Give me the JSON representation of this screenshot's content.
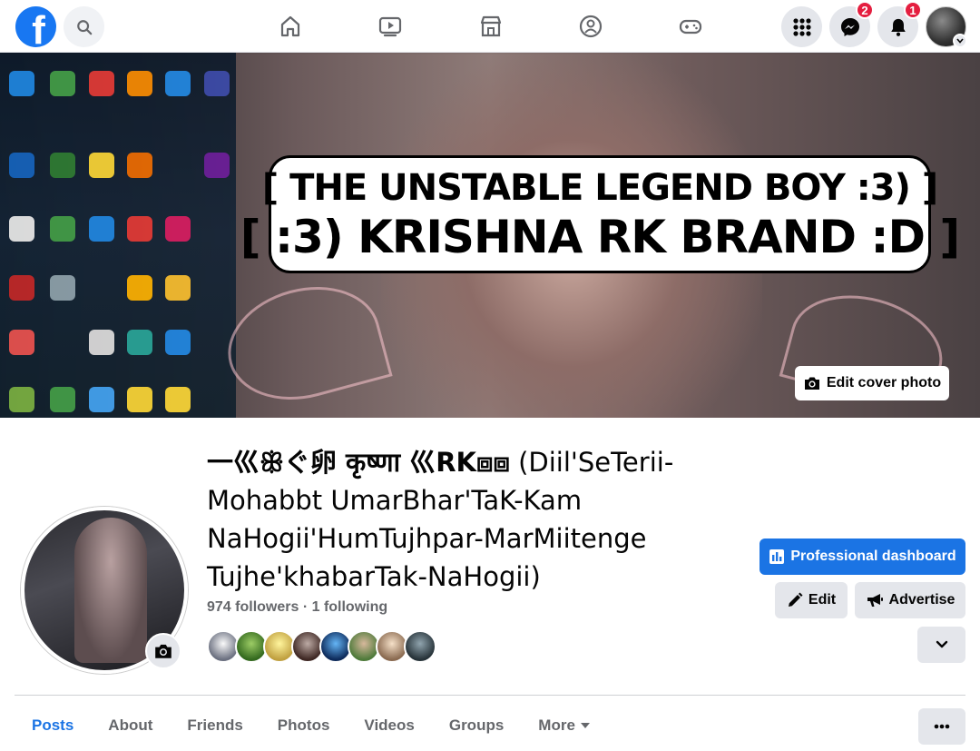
{
  "topbar": {
    "logo": "f",
    "nav_icons": [
      "home-icon",
      "video-icon",
      "marketplace-icon",
      "groups-icon",
      "gaming-icon"
    ],
    "messenger_badge": "2",
    "notifications_badge": "1"
  },
  "cover": {
    "banner_line1": "[ THE UNSTABLE LEGEND BOY :3) ]",
    "banner_line2": "[ :3) KRISHNA RK BRAND :D ]",
    "edit_label": "Edit cover photo"
  },
  "profile": {
    "name_main": "一巛ꕥぐ卵 कृष्णा 巛RK⧈⧈",
    "name_extra": "(Diil'SeTerii-Mohabbt UmarBhar'TaK-Kam NaHogii'HumTujhpar-MarMiitenge Tujhe'khabarTak-NaHogii)",
    "followers": "974 followers · 1 following"
  },
  "actions": {
    "dashboard_label": "Professional dashboard",
    "edit_label": "Edit",
    "advertise_label": "Advertise"
  },
  "tabs": [
    {
      "label": "Posts"
    },
    {
      "label": "About"
    },
    {
      "label": "Friends"
    },
    {
      "label": "Photos"
    },
    {
      "label": "Videos"
    },
    {
      "label": "Groups"
    },
    {
      "label": "More"
    }
  ],
  "colors": {
    "accent": "#1b74e4",
    "badge": "#e41e3f",
    "muted_text": "#65676b",
    "button_gray": "#e4e6eb"
  }
}
